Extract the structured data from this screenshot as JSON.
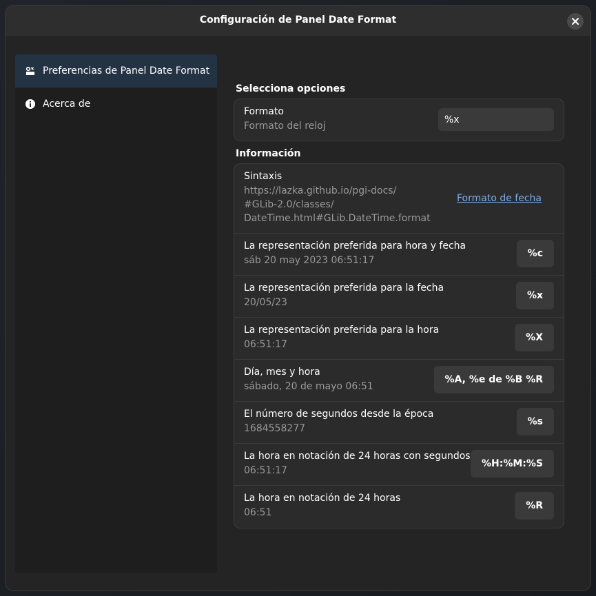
{
  "window": {
    "title": "Configuración de Panel Date Format"
  },
  "sidebar": {
    "items": [
      {
        "label": "Preferencias de Panel Date Format",
        "icon": "preferences-icon",
        "selected": true
      },
      {
        "label": "Acerca de",
        "icon": "info-icon",
        "selected": false
      }
    ]
  },
  "options": {
    "section_title": "Selecciona opciones",
    "format": {
      "title": "Formato",
      "subtitle": "Formato del reloj",
      "value": "%x"
    }
  },
  "info": {
    "section_title": "Información",
    "syntax": {
      "title": "Sintaxis",
      "url_lines": [
        "https://lazka.github.io/pgi-docs/",
        "#GLib-2.0/classes/",
        "DateTime.html#GLib.DateTime.format"
      ],
      "link": "Formato de fecha"
    },
    "rows": [
      {
        "title": "La representación preferida para hora y fecha",
        "subtitle": "sáb 20 may 2023 06:51:17",
        "code": "%c"
      },
      {
        "title": "La representación preferida para la fecha",
        "subtitle": "20/05/23",
        "code": "%x"
      },
      {
        "title": "La representación preferida para la hora",
        "subtitle": "06:51:17",
        "code": "%X"
      },
      {
        "title": "Día, mes y hora",
        "subtitle": "sábado, 20 de mayo 06:51",
        "code": "%A, %e de %B %R"
      },
      {
        "title": "El número de segundos desde la época",
        "subtitle": "1684558277",
        "code": "%s"
      },
      {
        "title": "La hora en notación de 24 horas con segundos",
        "subtitle": "06:51:17",
        "code": "%H:%M:%S"
      },
      {
        "title": "La hora en notación de 24 horas",
        "subtitle": "06:51",
        "code": "%R"
      }
    ]
  },
  "colors": {
    "accent_link": "#78aeed",
    "selected_bg": "#233344",
    "window_bg": "#242424"
  }
}
